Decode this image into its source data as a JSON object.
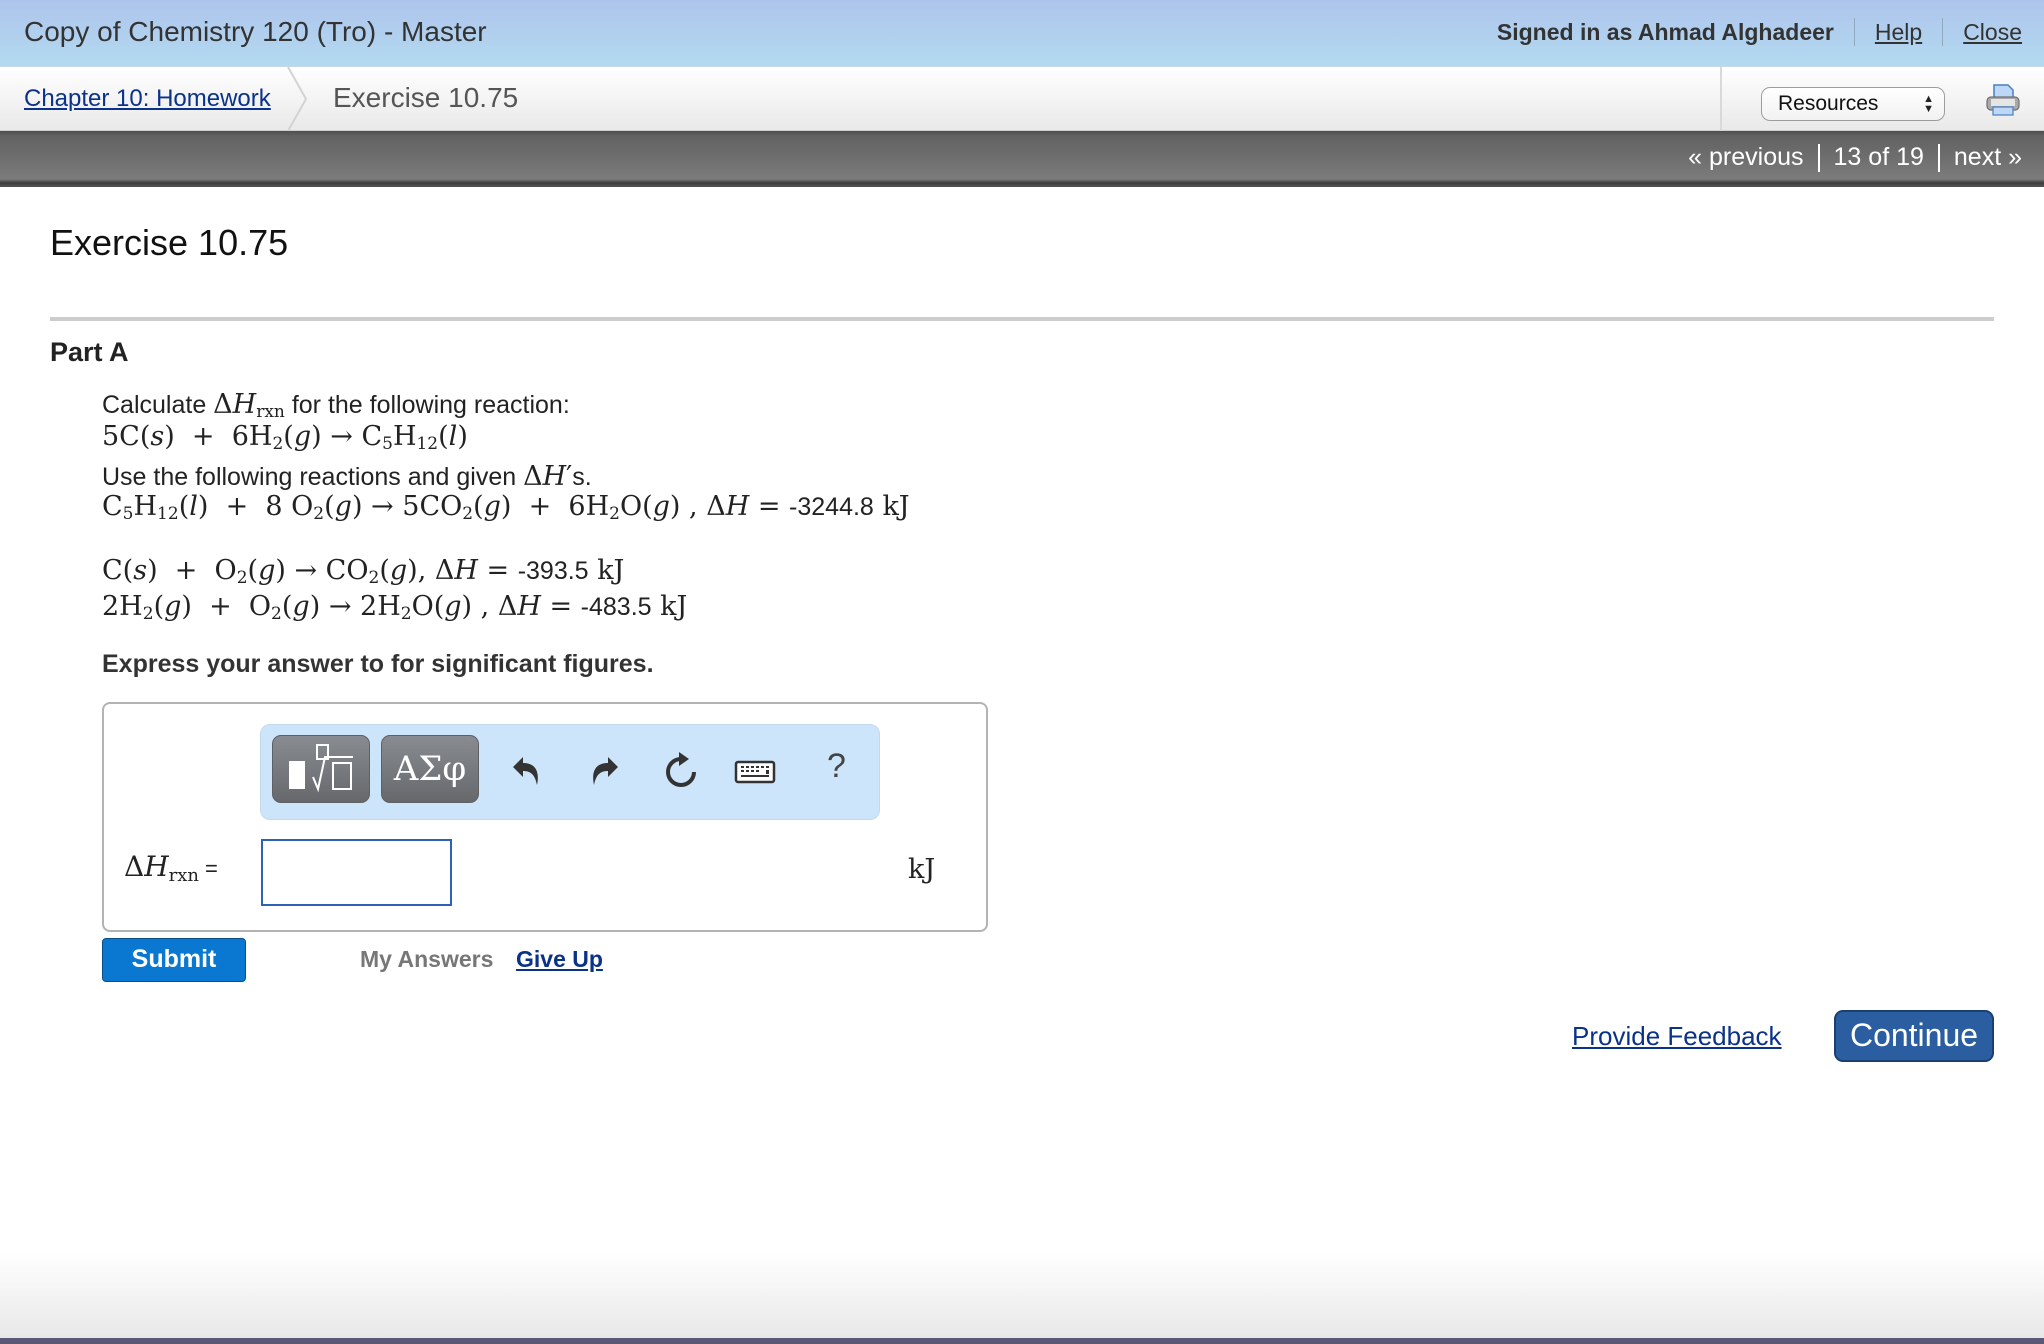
{
  "header": {
    "app_title": "Copy of Chemistry 120 (Tro) - Master",
    "signed_in": "Signed in as Ahmad Alghadeer",
    "help_label": "Help",
    "close_label": "Close"
  },
  "breadcrumb": {
    "parent_label": "Chapter 10: Homework",
    "current_label": "Exercise 10.75"
  },
  "resources": {
    "selected": "Resources",
    "icon": "printer-icon"
  },
  "nav": {
    "previous_label": "« previous",
    "position": "13 of 19",
    "next_label": "next »"
  },
  "exercise": {
    "title": "Exercise 10.75",
    "part_title": "Part A",
    "prompt_prefix": "Calculate ",
    "prompt_suffix": " for the following reaction:",
    "target_reaction": "5C(s) + 6H2(g) → C5H12(l)",
    "given_intro_prefix": "Use the following reactions and given ",
    "given_intro_suffix": "s.",
    "reactions": [
      {
        "equation": "C5H12(l) + 8 O2(g) → 5CO2(g) + 6H2O(g)",
        "dH_value": "-3244.8",
        "unit": "kJ"
      },
      {
        "equation": "C(s) + O2(g) → CO2(g)",
        "dH_value": "-393.5",
        "unit": "kJ"
      },
      {
        "equation": "2H2(g) + O2(g) → 2H2O(g)",
        "dH_value": "-483.5",
        "unit": "kJ"
      }
    ],
    "instruction": "Express your answer to for significant figures."
  },
  "answer": {
    "toolbar": {
      "templates_icon": "templates-icon",
      "symbols_label": "ΑΣφ",
      "undo_icon": "undo-icon",
      "redo_icon": "redo-icon",
      "reset_icon": "reset-icon",
      "keyboard_icon": "keyboard-icon",
      "help_label": "?"
    },
    "label_eq": "=",
    "input_value": "",
    "unit": "kJ"
  },
  "actions": {
    "submit_label": "Submit",
    "my_answers_label": "My Answers",
    "give_up_label": "Give Up",
    "feedback_label": "Provide Feedback",
    "continue_label": "Continue"
  },
  "colors": {
    "link": "#0a3289",
    "submit": "#0a77d0",
    "continue": "#2b5ea0",
    "toolbar_bg": "#cde5fb",
    "input_border": "#2d62b8"
  }
}
